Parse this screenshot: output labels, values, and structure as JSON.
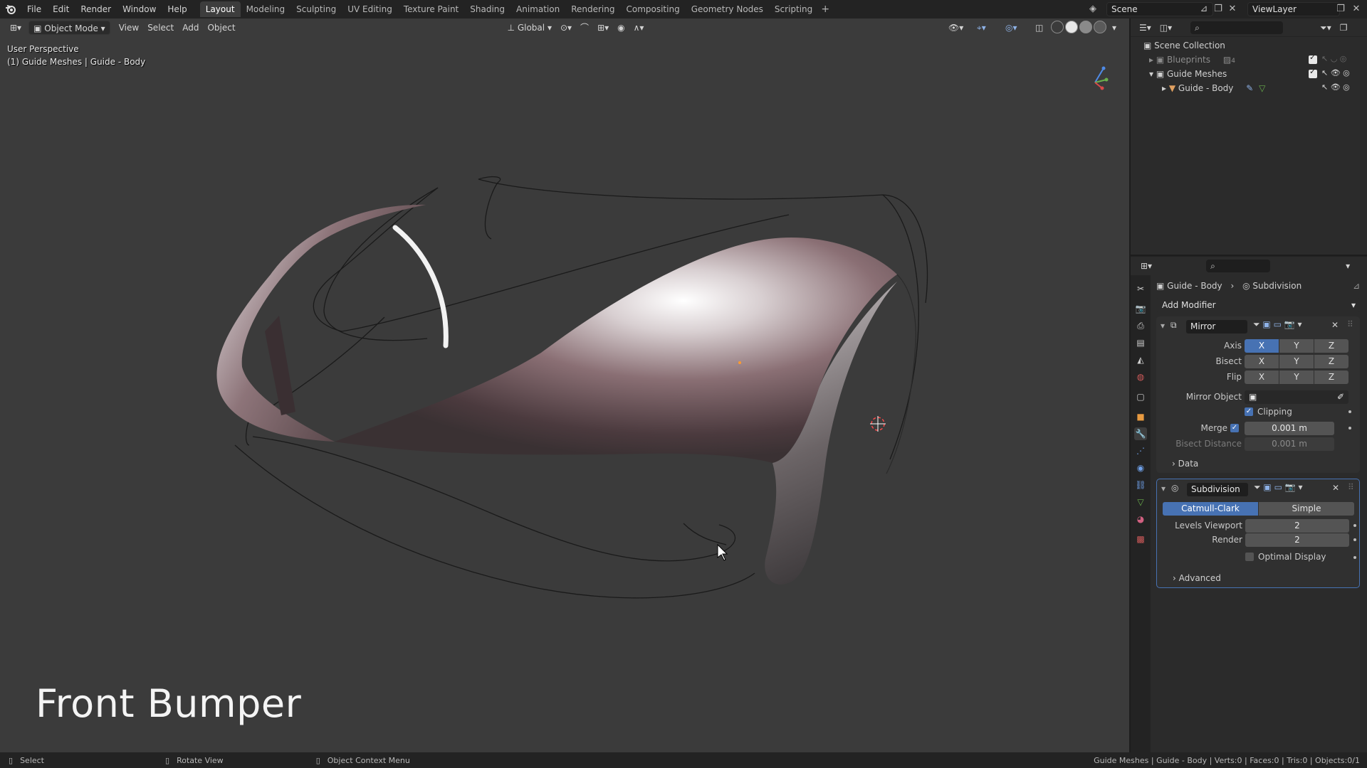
{
  "menu": {
    "items": [
      "File",
      "Edit",
      "Render",
      "Window",
      "Help"
    ],
    "workspaces": [
      "Layout",
      "Modeling",
      "Sculpting",
      "UV Editing",
      "Texture Paint",
      "Shading",
      "Animation",
      "Rendering",
      "Compositing",
      "Geometry Nodes",
      "Scripting"
    ],
    "active_workspace": "Layout",
    "scene_name": "Scene",
    "view_layer": "ViewLayer"
  },
  "viewport": {
    "mode": "Object Mode",
    "menus": [
      "View",
      "Select",
      "Add",
      "Object"
    ],
    "transform_orientation": "Global",
    "view_label": "User Perspective",
    "object_label": "(1) Guide Meshes | Guide - Body",
    "caption": "Front Bumper"
  },
  "outliner": {
    "root": "Scene Collection",
    "items": [
      {
        "label": "Blueprints",
        "badge": "4"
      },
      {
        "label": "Guide Meshes"
      },
      {
        "label": "Guide - Body"
      }
    ]
  },
  "properties": {
    "breadcrumb_object": "Guide - Body",
    "breadcrumb_modifier": "Subdivision",
    "add_modifier": "Add Modifier",
    "mirror": {
      "name": "Mirror",
      "axis_label": "Axis",
      "bisect_label": "Bisect",
      "flip_label": "Flip",
      "axes": [
        "X",
        "Y",
        "Z"
      ],
      "axis_enabled": [
        true,
        false,
        false
      ],
      "mirror_object_label": "Mirror Object",
      "clipping_label": "Clipping",
      "merge_label": "Merge",
      "merge_value": "0.001 m",
      "bisect_distance_label": "Bisect Distance",
      "bisect_distance_value": "0.001 m",
      "data_label": "Data"
    },
    "subdivision": {
      "name": "Subdivision",
      "methods": [
        "Catmull-Clark",
        "Simple"
      ],
      "active_method": "Catmull-Clark",
      "levels_viewport_label": "Levels Viewport",
      "levels_viewport": "2",
      "render_label": "Render",
      "render_levels": "2",
      "optimal_display_label": "Optimal Display",
      "advanced_label": "Advanced"
    }
  },
  "statusbar": {
    "select": "Select",
    "rotate": "Rotate View",
    "context": "Object Context Menu",
    "stats": "Guide Meshes | Guide - Body | Verts:0 | Faces:0 | Tris:0 | Objects:0/1"
  },
  "colors": {
    "accent": "#4772b3",
    "viewport_bg": "#3b3b3b",
    "panel_bg": "#2b2b2b"
  }
}
